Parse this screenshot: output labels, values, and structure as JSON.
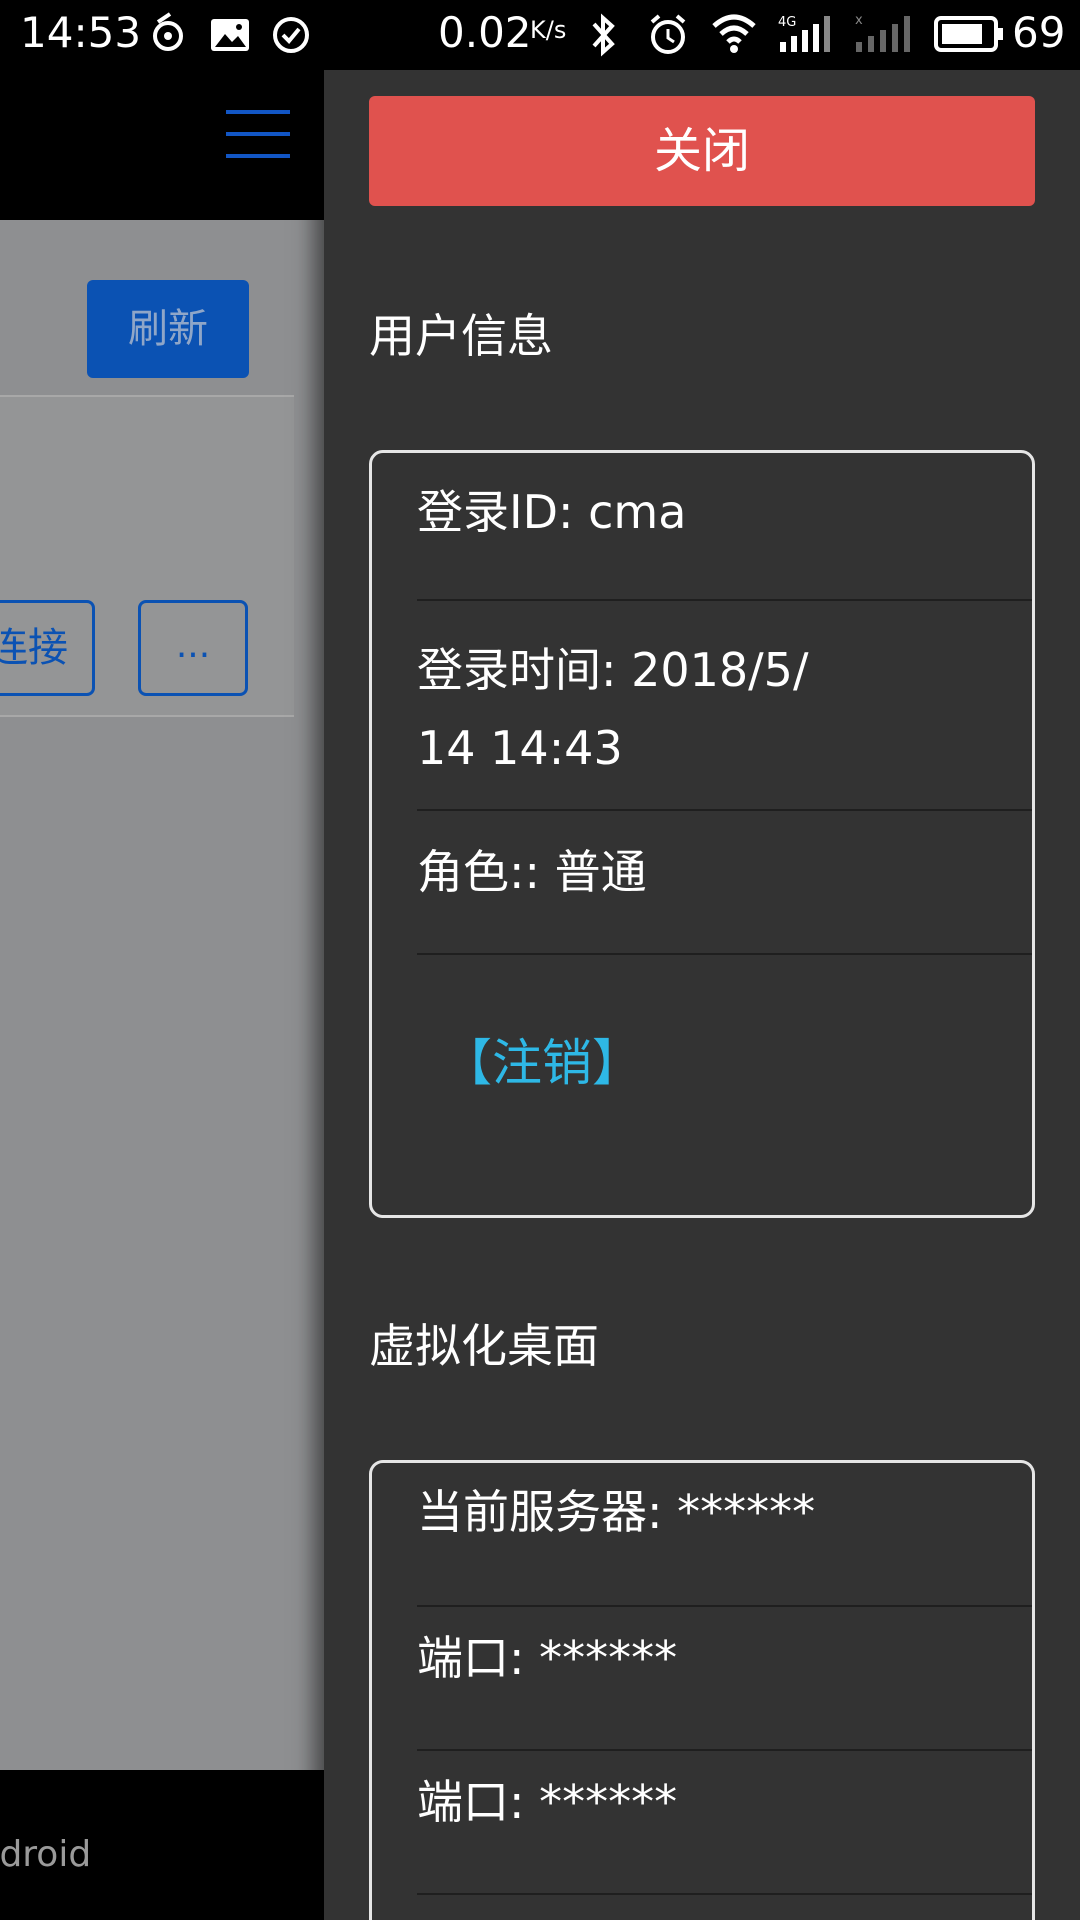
{
  "status_bar": {
    "time": "14:53",
    "net_speed": "0.02",
    "net_speed_unit": "K/s",
    "battery": "69",
    "icons": [
      "netease-icon",
      "image-icon",
      "check-circle-icon",
      "bluetooth-icon",
      "alarm-icon",
      "wifi-icon",
      "signal-4g-icon",
      "signal-empty-icon",
      "battery-icon"
    ]
  },
  "background_app": {
    "refresh_label": "刷新",
    "connect_label": "连接",
    "more_label": "...",
    "footer_text": "Android",
    "accent_color": "#0b52b3"
  },
  "drawer": {
    "close_label": "关闭",
    "user_section": {
      "title": "用户信息",
      "login_id": "登录ID: cma",
      "login_time_line1": "登录时间: 2018/5/",
      "login_time_line2": "14 14:43",
      "role": "角色:: 普通",
      "logout_label": "【注销】"
    },
    "desktop_section": {
      "title": "虚拟化桌面",
      "server": "当前服务器: ******",
      "port1": "端口: ******",
      "port2": "端口: ******"
    },
    "close_color": "#e0524e",
    "link_color": "#2eb8e6"
  }
}
